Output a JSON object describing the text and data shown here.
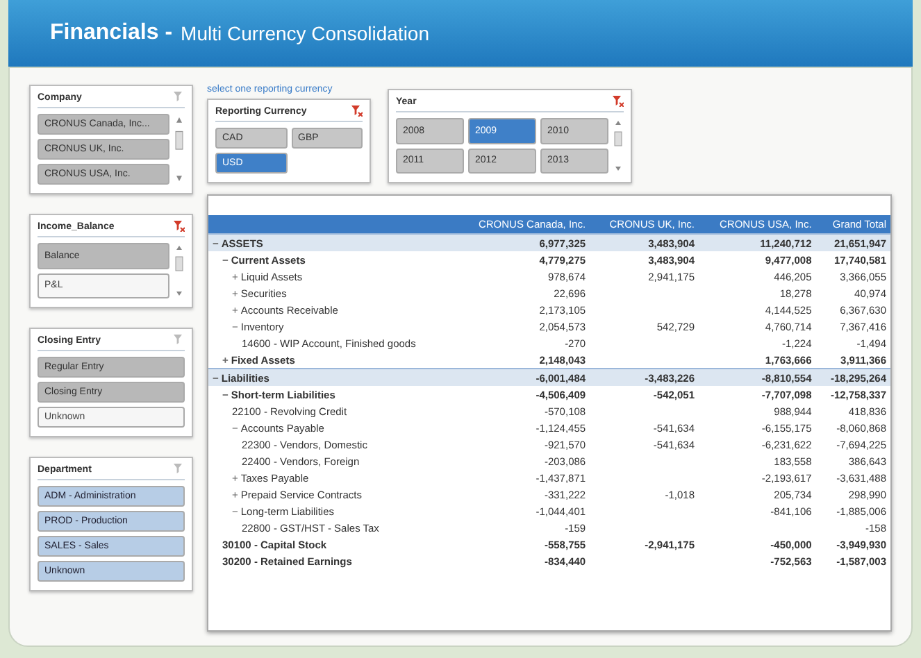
{
  "header": {
    "title": "Financials -",
    "subtitle": "Multi Currency Consolidation"
  },
  "slicers_left": [
    {
      "title": "Company",
      "filtered": false,
      "scrollable": true,
      "kind": "neutral",
      "items": [
        {
          "label": "CRONUS Canada, Inc...",
          "selected": true
        },
        {
          "label": "CRONUS UK, Inc.",
          "selected": true
        },
        {
          "label": "CRONUS USA, Inc.",
          "selected": true
        }
      ]
    },
    {
      "title": "Income_Balance",
      "filtered": true,
      "scrollable": true,
      "kind": "neutral",
      "items": [
        {
          "label": "Balance",
          "selected": true
        },
        {
          "label": "P&L",
          "selected": false
        }
      ]
    },
    {
      "title": "Closing Entry",
      "filtered": false,
      "kind": "neutral",
      "items": [
        {
          "label": "Regular Entry",
          "selected": true
        },
        {
          "label": "Closing Entry",
          "selected": true
        },
        {
          "label": "Unknown",
          "selected": false
        }
      ]
    },
    {
      "title": "Department",
      "filtered": false,
      "kind": "accent",
      "items": [
        {
          "label": "ADM - Administration",
          "selected": true
        },
        {
          "label": "PROD - Production",
          "selected": true
        },
        {
          "label": "SALES - Sales",
          "selected": true
        },
        {
          "label": "Unknown",
          "selected": true
        }
      ]
    }
  ],
  "currency_hint": "select one reporting currency",
  "currency_slicer": {
    "title": "Reporting Currency",
    "filtered": true,
    "kind": "pick",
    "items": [
      {
        "label": "CAD",
        "selected": false
      },
      {
        "label": "GBP",
        "selected": false
      },
      {
        "label": "USD",
        "selected": true
      }
    ]
  },
  "year_slicer": {
    "title": "Year",
    "filtered": true,
    "scrollable": true,
    "kind": "pick",
    "items": [
      {
        "label": "2008",
        "selected": false
      },
      {
        "label": "2009",
        "selected": true
      },
      {
        "label": "2010",
        "selected": false
      },
      {
        "label": "2011",
        "selected": false
      },
      {
        "label": "2012",
        "selected": false
      },
      {
        "label": "2013",
        "selected": false
      }
    ]
  },
  "table": {
    "columns": [
      "CRONUS Canada, Inc.",
      "CRONUS UK, Inc.",
      "CRONUS USA, Inc.",
      "Grand Total"
    ],
    "rows": [
      {
        "label": "ASSETS",
        "toggle": "−",
        "kind": "section",
        "values": {
          "col_1": "6,977,325",
          "col_2": "3,483,904",
          "col_3": "11,240,712",
          "col_4": "21,651,947"
        },
        "children": [
          {
            "label": "Current Assets",
            "toggle": "−",
            "kind": "group",
            "values": {
              "col_1": "4,779,275",
              "col_2": "3,483,904",
              "col_3": "9,477,008",
              "col_4": "17,740,581"
            },
            "children": [
              {
                "label": "Liquid Assets",
                "toggle": "+",
                "kind": "item",
                "values": {
                  "col_1": "978,674",
                  "col_2": "2,941,175",
                  "col_3": "446,205",
                  "col_4": "3,366,055"
                }
              },
              {
                "label": "Securities",
                "toggle": "+",
                "kind": "item",
                "values": {
                  "col_1": "22,696",
                  "col_3": "18,278",
                  "col_4": "40,974"
                }
              },
              {
                "label": "Accounts Receivable",
                "toggle": "+",
                "kind": "item",
                "values": {
                  "col_1": "2,173,105",
                  "col_3": "4,144,525",
                  "col_4": "6,367,630"
                }
              },
              {
                "label": "Inventory",
                "toggle": "−",
                "kind": "item",
                "values": {
                  "col_1": "2,054,573",
                  "col_2": "542,729",
                  "col_3": "4,760,714",
                  "col_4": "7,367,416"
                },
                "children": [
                  {
                    "label": "14600 - WIP Account, Finished goods",
                    "kind": "item",
                    "values": {
                      "col_1": "-270",
                      "col_3": "-1,224",
                      "col_4": "-1,494"
                    }
                  }
                ]
              }
            ]
          },
          {
            "label": "Fixed Assets",
            "toggle": "+",
            "kind": "group",
            "values": {
              "col_1": "2,148,043",
              "col_3": "1,763,666",
              "col_4": "3,911,366"
            }
          }
        ]
      },
      {
        "label": "Liabilities",
        "toggle": "−",
        "kind": "section",
        "values": {
          "col_1": "-6,001,484",
          "col_2": "-3,483,226",
          "col_3": "-8,810,554",
          "col_4": "-18,295,264"
        },
        "children": [
          {
            "label": "Short-term Liabilities",
            "toggle": "−",
            "kind": "group",
            "values": {
              "col_1": "-4,506,409",
              "col_2": "-542,051",
              "col_3": "-7,707,098",
              "col_4": "-12,758,337"
            },
            "children": [
              {
                "label": "22100 - Revolving Credit",
                "kind": "item",
                "values": {
                  "col_1": "-570,108",
                  "col_3": "988,944",
                  "col_4": "418,836"
                }
              },
              {
                "label": "Accounts Payable",
                "toggle": "−",
                "kind": "item",
                "values": {
                  "col_1": "-1,124,455",
                  "col_2": "-541,634",
                  "col_3": "-6,155,175",
                  "col_4": "-8,060,868"
                },
                "children": [
                  {
                    "label": "22300 - Vendors, Domestic",
                    "kind": "item",
                    "values": {
                      "col_1": "-921,570",
                      "col_2": "-541,634",
                      "col_3": "-6,231,622",
                      "col_4": "-7,694,225"
                    }
                  },
                  {
                    "label": "22400 - Vendors, Foreign",
                    "kind": "item",
                    "values": {
                      "col_1": "-203,086",
                      "col_3": "183,558",
                      "col_4": "386,643"
                    }
                  }
                ]
              },
              {
                "label": "Taxes Payable",
                "toggle": "+",
                "kind": "item",
                "values": {
                  "col_1": "-1,437,871",
                  "col_3": "-2,193,617",
                  "col_4": "-3,631,488"
                }
              },
              {
                "label": "Prepaid Service Contracts",
                "toggle": "+",
                "kind": "item",
                "values": {
                  "col_1": "-331,222",
                  "col_2": "-1,018",
                  "col_3": "205,734",
                  "col_4": "298,990"
                }
              },
              {
                "label": "Long-term Liabilities",
                "toggle": "−",
                "kind": "item",
                "values": {
                  "col_1": "-1,044,401",
                  "col_3": "-841,106",
                  "col_4": "-1,885,006"
                },
                "children": [
                  {
                    "label": "22800 - GST/HST - Sales Tax",
                    "kind": "item",
                    "values": {
                      "col_1": "-159",
                      "col_4": "-158"
                    }
                  }
                ]
              }
            ]
          },
          {
            "label": "30100 - Capital Stock",
            "kind": "group",
            "values": {
              "col_1": "-558,755",
              "col_2": "-2,941,175",
              "col_3": "-450,000",
              "col_4": "-3,949,930"
            }
          },
          {
            "label": "30200 - Retained Earnings",
            "kind": "group",
            "values": {
              "col_1": "-834,440",
              "col_3": "-752,563",
              "col_4": "-1,587,003"
            }
          }
        ]
      }
    ]
  }
}
